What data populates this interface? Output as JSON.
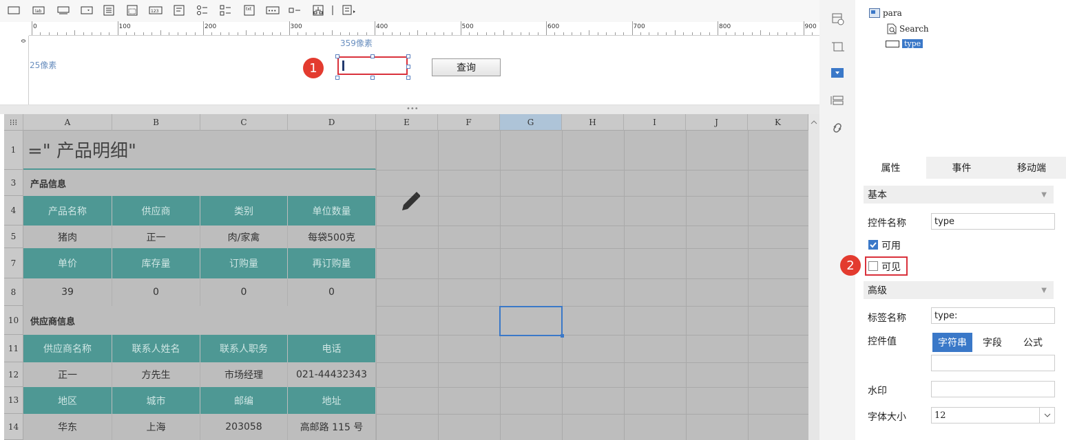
{
  "toolbar": {
    "icons": [
      "textbox-icon",
      "label-icon",
      "button-icon",
      "dropdown-icon",
      "dropdown-tree-icon",
      "date-icon",
      "number-icon",
      "textarea-icon",
      "radio-group-icon",
      "checkbox-group-icon",
      "text-icon",
      "password-icon",
      "checkbox-icon",
      "tree-icon",
      "more-icon"
    ]
  },
  "ruler": {
    "marks": [
      "0",
      "100",
      "200",
      "300",
      "400",
      "500",
      "600",
      "700",
      "800",
      "900"
    ]
  },
  "param": {
    "width_label": "359像素",
    "height_label": "25像素",
    "query_button": "查询",
    "badge1": "1"
  },
  "sheet": {
    "columns": [
      "A",
      "B",
      "C",
      "D",
      "E",
      "F",
      "G",
      "H",
      "I",
      "J",
      "K"
    ],
    "rows": [
      "1",
      "3",
      "4",
      "5",
      "7",
      "8",
      "10",
      "11",
      "12",
      "13",
      "14"
    ],
    "title": "=\" 产品明细\"",
    "product_info": "产品信息",
    "supplier_info": "供应商信息",
    "row4": [
      "产品名称",
      "供应商",
      "类别",
      "单位数量"
    ],
    "row5": [
      "猪肉",
      "正一",
      "肉/家禽",
      "每袋500克"
    ],
    "row7": [
      "单价",
      "库存量",
      "订购量",
      "再订购量"
    ],
    "row8": [
      "39",
      "0",
      "0",
      "0"
    ],
    "row11": [
      "供应商名称",
      "联系人姓名",
      "联系人职务",
      "电话"
    ],
    "row12": [
      "正一",
      "方先生",
      "市场经理",
      "021-44432343"
    ],
    "row13": [
      "地区",
      "城市",
      "邮编",
      "地址"
    ],
    "row14": [
      "华东",
      "上海",
      "203058",
      "高邮路 115 号"
    ]
  },
  "tree": {
    "root": "para",
    "child1": "Search",
    "child2": "type"
  },
  "tabs": [
    "属性",
    "事件",
    "移动端"
  ],
  "props": {
    "basic": "基本",
    "name_label": "控件名称",
    "name_value": "type",
    "enabled": "可用",
    "visible": "可见",
    "advanced": "高级",
    "tag_label": "标签名称",
    "tag_value": "type:",
    "value_label": "控件值",
    "value_modes": [
      "字符串",
      "字段",
      "公式"
    ],
    "watermark": "水印",
    "fontsize_label": "字体大小",
    "fontsize_value": "12",
    "badge2": "2"
  },
  "colors": {
    "teal": "#4e9894",
    "select": "#3a78c8",
    "badge": "#e33b2f"
  }
}
